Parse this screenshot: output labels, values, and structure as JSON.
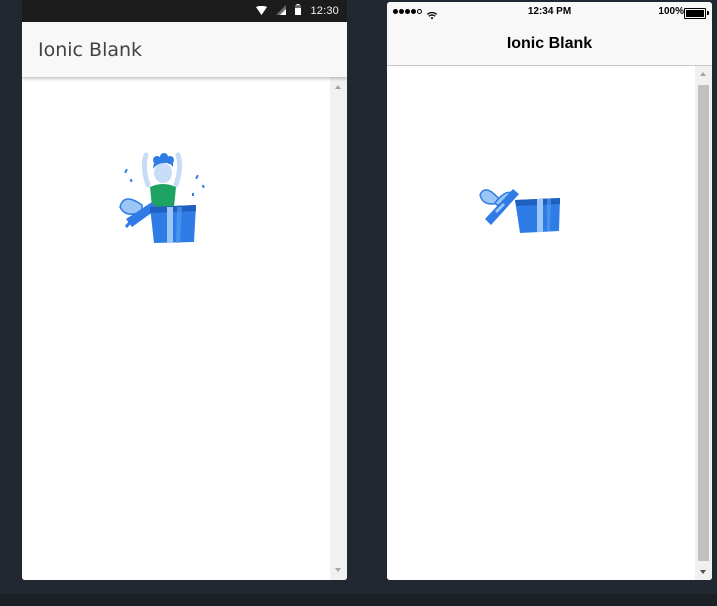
{
  "android": {
    "status_time": "12:30",
    "title": "Ionic Blank",
    "icons": [
      "wifi-icon",
      "signal-icon",
      "battery-icon"
    ],
    "illustration": "person-popping-out-of-gift-box"
  },
  "ios": {
    "status_time": "12:34 PM",
    "battery_percent": "100%",
    "title": "Ionic Blank",
    "icons": [
      "signal-dots-icon",
      "wifi-icon",
      "battery-icon"
    ],
    "illustration": "open-gift-box"
  },
  "colors": {
    "background": "#222831",
    "gift_blue": "#2f7ce6",
    "gift_light": "#9cc6f5",
    "shirt_green": "#1ea362",
    "hair_blue": "#2f7ce6",
    "skin_light": "#c7dcf6"
  }
}
